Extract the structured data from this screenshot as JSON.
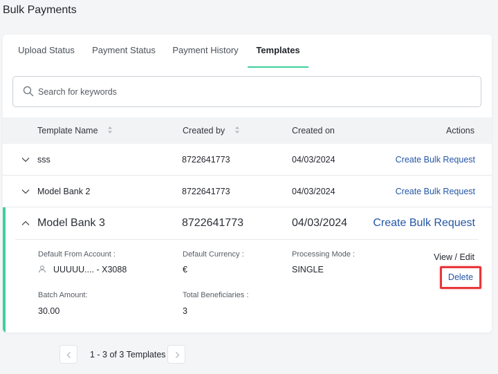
{
  "page": {
    "title": "Bulk Payments"
  },
  "tabs": [
    {
      "label": "Upload Status"
    },
    {
      "label": "Payment Status"
    },
    {
      "label": "Payment History"
    },
    {
      "label": "Templates"
    }
  ],
  "search": {
    "placeholder": "Search for keywords",
    "value": ""
  },
  "table": {
    "headers": {
      "template_name": "Template Name",
      "created_by": "Created by",
      "created_on": "Created on",
      "actions": "Actions"
    },
    "rows": [
      {
        "name": "sss",
        "created_by": "8722641773",
        "created_on": "04/03/2024",
        "action": "Create Bulk Request"
      },
      {
        "name": "Model Bank 2",
        "created_by": "8722641773",
        "created_on": "04/03/2024",
        "action": "Create Bulk Request"
      },
      {
        "name": "Model Bank 3",
        "created_by": "8722641773",
        "created_on": "04/03/2024",
        "action": "Create Bulk Request"
      }
    ]
  },
  "details": {
    "default_from_account_label": "Default From Account :",
    "default_from_account_value": "UUUUU.... - X3088",
    "default_currency_label": "Default Currency :",
    "default_currency_value": "€",
    "processing_mode_label": "Processing Mode :",
    "processing_mode_value": "SINGLE",
    "batch_amount_label": "Batch Amount:",
    "batch_amount_value": "30.00",
    "total_beneficiaries_label": "Total Beneficiaries :",
    "total_beneficiaries_value": "3",
    "view_edit_label": "View / Edit",
    "delete_label": "Delete"
  },
  "pagination": {
    "summary": "1 - 3 of 3 Templates"
  },
  "colors": {
    "accent": "#3ecf9a",
    "link": "#2355a6",
    "highlight": "#e8363b"
  }
}
